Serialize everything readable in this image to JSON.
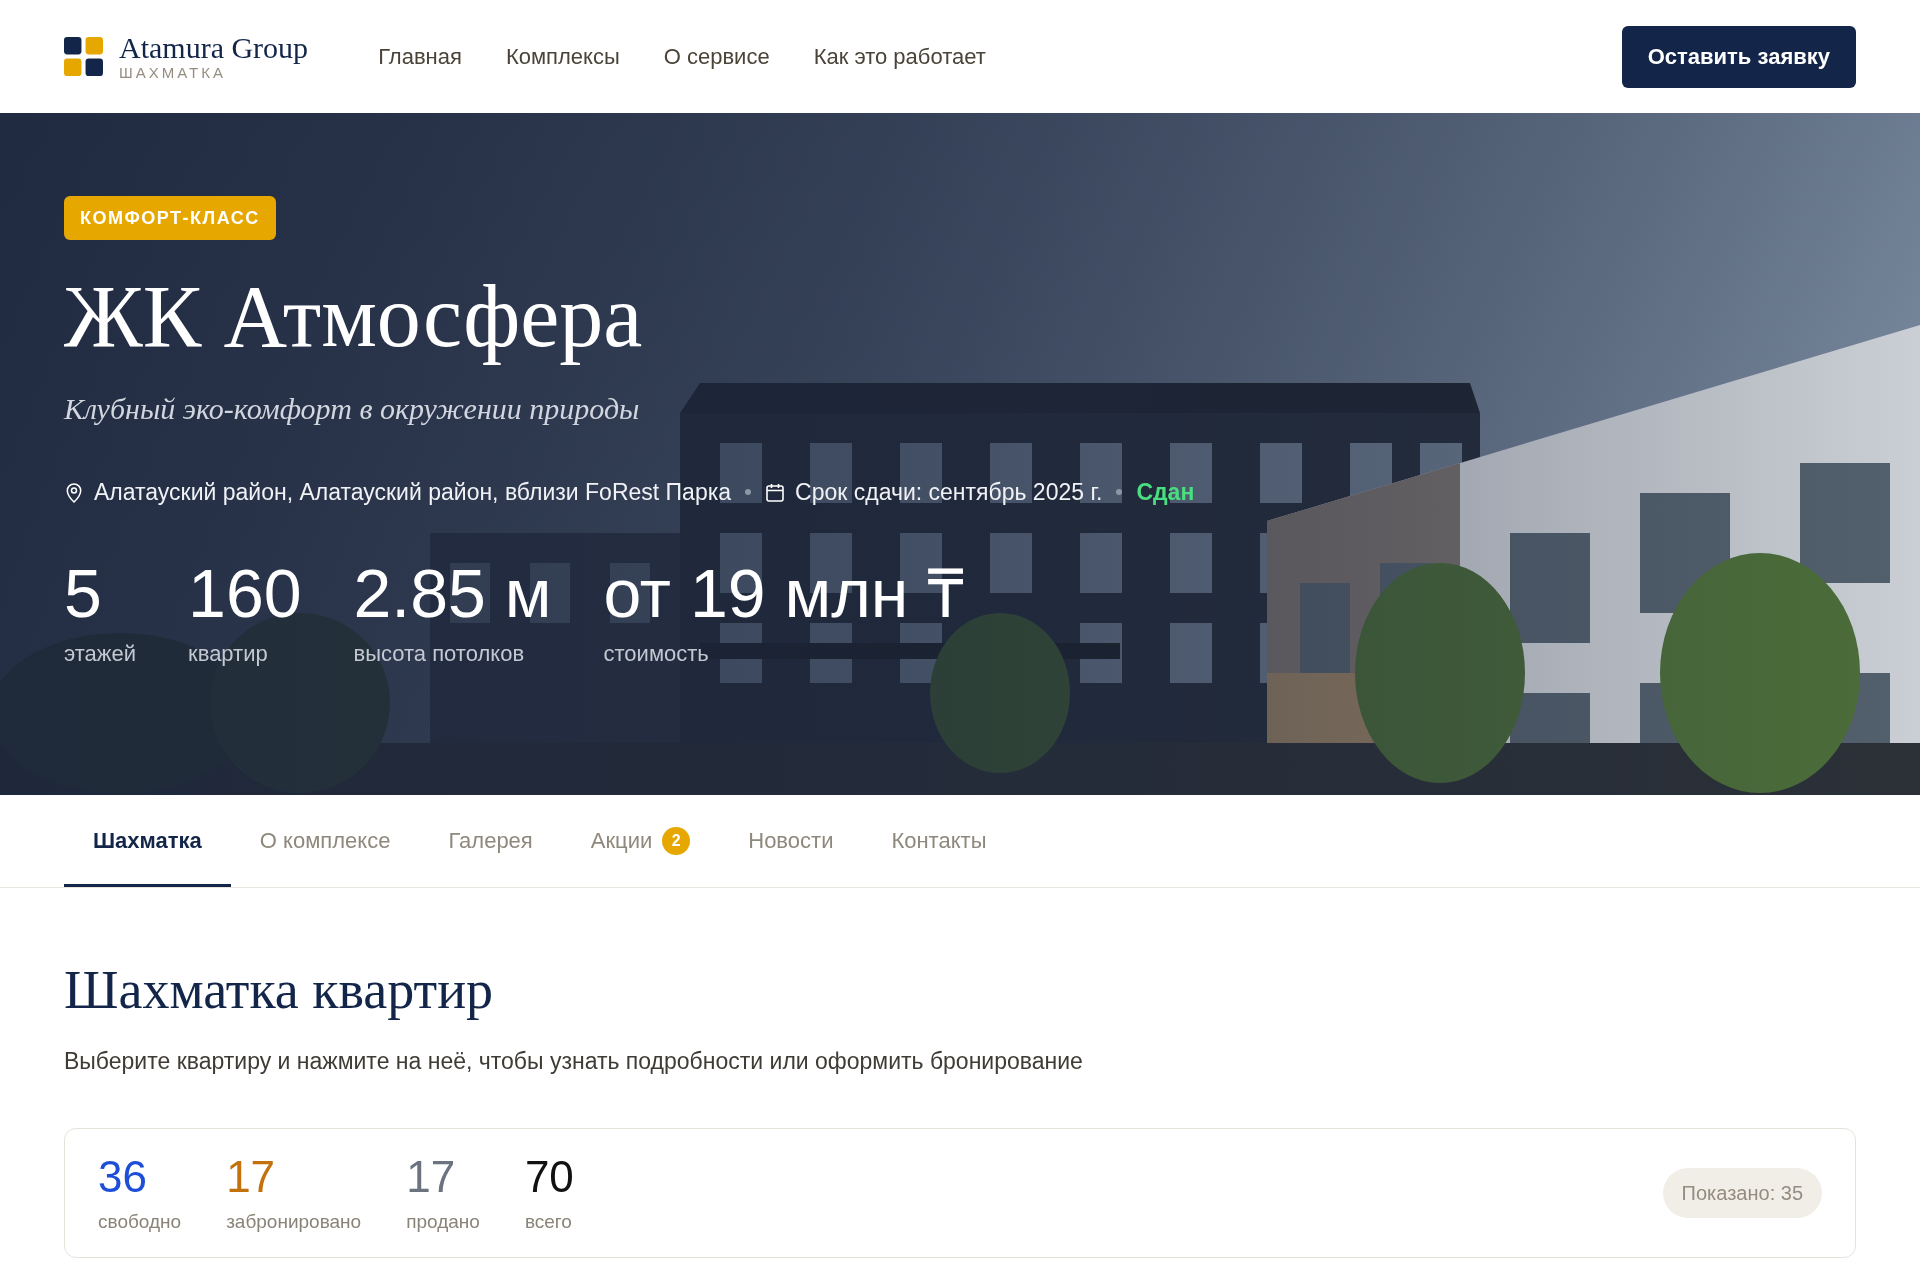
{
  "header": {
    "logo": {
      "name": "Atamura Group",
      "subtitle": "ШАХМАТКА"
    },
    "nav": [
      "Главная",
      "Комплексы",
      "О сервисе",
      "Как это работает"
    ],
    "cta_button": "Оставить заявку"
  },
  "hero": {
    "badge": "КОМФОРТ-КЛАСС",
    "title": "ЖК Атмосфера",
    "subtitle": "Клубный эко-комфорт в окружении природы",
    "address": "Алатауский район, Алатауский район, вблизи FoRest Парка",
    "deadline": "Срок сдачи: сентябрь 2025 г.",
    "status": "Сдан",
    "stats": [
      {
        "value": "5",
        "label": "этажей"
      },
      {
        "value": "160",
        "label": "квартир"
      },
      {
        "value": "2.85 м",
        "label": "высота потолков"
      },
      {
        "value": "от 19 млн ₸",
        "label": "стоимость"
      }
    ]
  },
  "tabs": [
    {
      "label": "Шахматка",
      "selected": true
    },
    {
      "label": "О комплексе",
      "selected": false
    },
    {
      "label": "Галерея",
      "selected": false
    },
    {
      "label": "Акции",
      "selected": false,
      "badge": "2"
    },
    {
      "label": "Новости",
      "selected": false
    },
    {
      "label": "Контакты",
      "selected": false
    }
  ],
  "section": {
    "title": "Шахматка квартир",
    "description": "Выберите квартиру и нажмите на неё, чтобы узнать подробности или оформить бронирование",
    "summary": {
      "counts": [
        {
          "value": "36",
          "label": "свободно",
          "color": "#1d4ed8"
        },
        {
          "value": "17",
          "label": "забронировано",
          "color": "#c2710c"
        },
        {
          "value": "17",
          "label": "продано",
          "color": "#6b7280"
        },
        {
          "value": "70",
          "label": "всего",
          "color": "#111111"
        }
      ],
      "shown": "Показано: 35"
    }
  }
}
